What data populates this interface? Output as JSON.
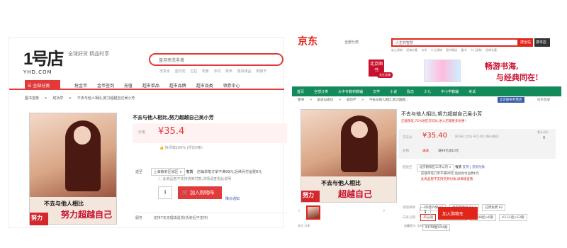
{
  "yhd": {
    "logo_big": "1号店",
    "logo_small": "YHD.COM",
    "slogan": "全球好货 精品时享",
    "search_placeholder": "蓝月亮洗手液",
    "hot_words": [
      "洗发水",
      "蓝月亮",
      "拉拉",
      "零食",
      "手机",
      "新米",
      "厨具用品",
      "购物卡"
    ],
    "category_button": "全部分类",
    "nav_items": [
      "抢金币",
      "金币签到",
      "充值",
      "超市单品",
      "超市品牌",
      "超市品类",
      "领券中心"
    ],
    "breadcrumb": [
      "图书音像",
      ">",
      "成功学",
      ">",
      "不去与他人相比,努力超越自己吴小芳"
    ],
    "book_title_line1": "不去与他人相比",
    "book_title_line2": "努力超越自己",
    "book_badge": "努力",
    "title": "不去与他人相比,努力超越自己吴小芳",
    "price_label": "价格",
    "price": "¥35.4",
    "good_rate": "好评率100% (评论0条)",
    "ship_label": "送至",
    "ship_select": "上海静安区城区 ∨",
    "ship_stock": "有货",
    "ship_note": "店铺单笔订单不满99元,后续另付运费8元",
    "ship_warn": "此商品暂不支持货到付款,详情请查看此说明",
    "qty": "1",
    "cart_button": "加入购物车",
    "related_link": "降价通知",
    "service_label": "服务",
    "service_text": "支持7天无理由退货(拆封后不支持)"
  },
  "jd": {
    "logo": "京东",
    "location": "全部分类",
    "search_value": "人生的智慧",
    "search_btn": "搜全站",
    "search_btn2": "搜本店",
    "hot_words": [
      "幼儿读物",
      "经典名著",
      "文学",
      "少儿读物",
      "图书精选",
      "童书",
      "少儿读物",
      "经典名著",
      "文学",
      "少儿读物"
    ],
    "shop_logo": "北京图书",
    "follow_btn": "关注店铺",
    "calligraphy_line1": "畅游书海,",
    "calligraphy_line2": "与经典同在!",
    "nav_items": [
      "首页",
      "全部分类",
      "大中专教材教辅",
      "文学",
      "小说",
      "励志",
      "少儿",
      "中小学教辅",
      "考试"
    ],
    "breadcrumb": [
      "图书",
      ">",
      "励志与成功",
      ">",
      "成功学",
      ">",
      "不去与他人相比,努力超越..."
    ],
    "store_name": "北京图书专营店",
    "store_link": "联系客服",
    "book_title_line1": "不去与他人相比",
    "book_title_line2": "超越自己",
    "book_badge": "努力",
    "title": "不去与他人相比,努力超越自己吴小芳",
    "promo": "正版保证,72%地区次日达,进入店铺更多优惠!",
    "price_label": "京东价",
    "price": "¥35.40",
    "price_discount": "[8.6折] [定价 ¥41.00] [降价通知]",
    "review_label": "累计评价",
    "review_count": "0",
    "promo_label": "促销",
    "promo_tag": "满减",
    "promo_text": "满99元减10元",
    "ship_label": "配送至",
    "ship_select": "北京朝阳区三环以内 ∨",
    "ship_stock": "有货",
    "ship_support": "支持 | 货到付款",
    "ship_note": "店铺单笔订单不满99元,后续另付运费6元",
    "ship_warn": "此商品暂不支持货到付款,详情请查看",
    "option_label1": "增值保障",
    "options1": [
      "1年意外保 ¥1",
      "半年期图书 ¥1.2",
      "已用免费 ¥2"
    ],
    "option_label2": "白条分期",
    "options2": [
      "不分期",
      "¥11.98起×3期",
      "¥6.08起×6期",
      "¥3.11起×12期"
    ],
    "options3": [
      "¥1.54起×24期"
    ],
    "qty": "1",
    "cart_button": "加入购物车",
    "footer_left": "关注  分享",
    "footer_right": "温馨提示: 支持7天无理由退货"
  }
}
